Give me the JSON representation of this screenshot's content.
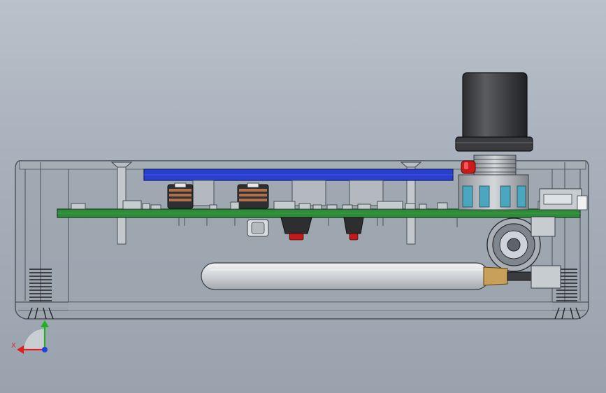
{
  "viewport": {
    "background_top": "#b9c1ca",
    "background_bottom": "#9aa3ad"
  },
  "triad": {
    "x_label": "X",
    "x_color": "#e02020",
    "y_color": "#20b020",
    "z_color": "#2040e0"
  },
  "colors": {
    "enclosure": "#8f979f",
    "pcb": "#2f8a3a",
    "display": "#2b3fcf",
    "knob": "#3e3f41",
    "led": "#cc1a1a",
    "battery": "#c9cccf",
    "battery_tip": "#c8a05a",
    "inductor_copper": "#b0704a"
  },
  "parts": [
    "enclosure",
    "pcb",
    "display",
    "knob",
    "encoder",
    "led",
    "inductor",
    "battery",
    "screw",
    "button",
    "audio-jack",
    "foot"
  ]
}
